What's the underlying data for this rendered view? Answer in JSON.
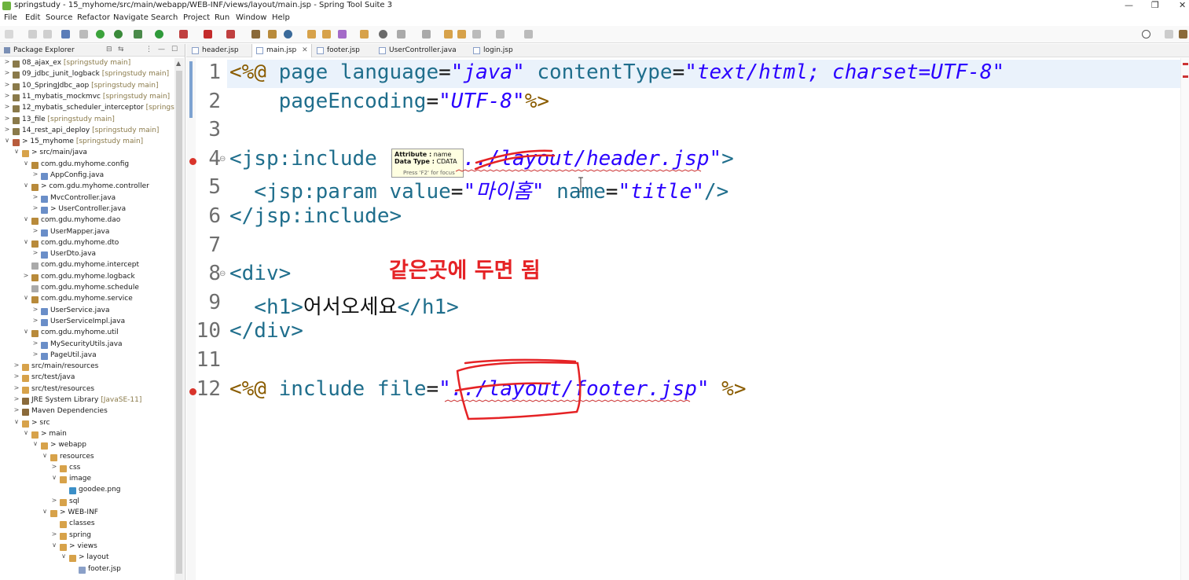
{
  "window": {
    "title": "springstudy - 15_myhome/src/main/webapp/WEB-INF/views/layout/main.jsp - Spring Tool Suite 3",
    "controls": {
      "minimize": "—",
      "restore": "❐",
      "close": "✕"
    }
  },
  "menu": [
    "File",
    "Edit",
    "Source",
    "Refactor",
    "Navigate",
    "Search",
    "Project",
    "Run",
    "Window",
    "Help"
  ],
  "package_explorer": {
    "title": "Package Explorer",
    "buttons": {
      "collapse": "⊟",
      "link": "⇆",
      "menu": "⋮",
      "minimize": "—",
      "maximize": "☐"
    },
    "scroll_up": "▲",
    "items": [
      {
        "twisty": ">",
        "label": "08_ajax_ex",
        "meta": " [springstudy main]",
        "icon_color": "#8a7a4a"
      },
      {
        "twisty": ">",
        "label": "09_jdbc_junit_logback",
        "meta": " [springstudy main]",
        "icon_color": "#8a7a4a"
      },
      {
        "twisty": ">",
        "label": "10_SpringJdbc_aop",
        "meta": " [springstudy main]",
        "icon_color": "#8a7a4a"
      },
      {
        "twisty": ">",
        "label": "11_mybatis_mockmvc",
        "meta": " [springstudy main]",
        "icon_color": "#8a7a4a"
      },
      {
        "twisty": ">",
        "label": "12_mybatis_scheduler_interceptor",
        "meta": " [springstu",
        "icon_color": "#8a7a4a"
      },
      {
        "twisty": ">",
        "label": "13_file",
        "meta": " [springstudy main]",
        "icon_color": "#8a7a4a"
      },
      {
        "twisty": ">",
        "label": "14_rest_api_deploy",
        "meta": " [springstudy main]",
        "icon_color": "#8a7a4a"
      },
      {
        "twisty": "∨",
        "label": "> 15_myhome",
        "meta": " [springstudy main]",
        "icon_color": "#b85c3c"
      },
      {
        "twisty": "∨",
        "label": "> src/main/java",
        "meta": "",
        "icon_color": "#d7a24a"
      },
      {
        "twisty": "∨",
        "label": "com.gdu.myhome.config",
        "meta": "",
        "icon_color": "#b88a3a"
      },
      {
        "twisty": ">",
        "label": "AppConfig.java",
        "meta": "",
        "icon_color": "#6a8ec8"
      },
      {
        "twisty": "∨",
        "label": "> com.gdu.myhome.controller",
        "meta": "",
        "icon_color": "#b88a3a"
      },
      {
        "twisty": ">",
        "label": "MvcController.java",
        "meta": "",
        "icon_color": "#6a8ec8"
      },
      {
        "twisty": ">",
        "label": "> UserController.java",
        "meta": "",
        "icon_color": "#6a8ec8"
      },
      {
        "twisty": "∨",
        "label": "com.gdu.myhome.dao",
        "meta": "",
        "icon_color": "#b88a3a"
      },
      {
        "twisty": ">",
        "label": "UserMapper.java",
        "meta": "",
        "icon_color": "#6a8ec8"
      },
      {
        "twisty": "∨",
        "label": "com.gdu.myhome.dto",
        "meta": "",
        "icon_color": "#b88a3a"
      },
      {
        "twisty": ">",
        "label": "UserDto.java",
        "meta": "",
        "icon_color": "#6a8ec8"
      },
      {
        "twisty": "",
        "label": "com.gdu.myhome.intercept",
        "meta": "",
        "icon_color": "#aaaaaa"
      },
      {
        "twisty": ">",
        "label": "com.gdu.myhome.logback",
        "meta": "",
        "icon_color": "#b88a3a"
      },
      {
        "twisty": "",
        "label": "com.gdu.myhome.schedule",
        "meta": "",
        "icon_color": "#aaaaaa"
      },
      {
        "twisty": "∨",
        "label": "com.gdu.myhome.service",
        "meta": "",
        "icon_color": "#b88a3a"
      },
      {
        "twisty": ">",
        "label": "UserService.java",
        "meta": "",
        "icon_color": "#6a8ec8"
      },
      {
        "twisty": ">",
        "label": "UserServiceImpl.java",
        "meta": "",
        "icon_color": "#6a8ec8"
      },
      {
        "twisty": "∨",
        "label": "com.gdu.myhome.util",
        "meta": "",
        "icon_color": "#b88a3a"
      },
      {
        "twisty": ">",
        "label": "MySecurityUtils.java",
        "meta": "",
        "icon_color": "#6a8ec8"
      },
      {
        "twisty": ">",
        "label": "PageUtil.java",
        "meta": "",
        "icon_color": "#6a8ec8"
      },
      {
        "twisty": ">",
        "label": "src/main/resources",
        "meta": "",
        "icon_color": "#d7a24a"
      },
      {
        "twisty": ">",
        "label": "src/test/java",
        "meta": "",
        "icon_color": "#d7a24a"
      },
      {
        "twisty": ">",
        "label": "src/test/resources",
        "meta": "",
        "icon_color": "#d7a24a"
      },
      {
        "twisty": ">",
        "label": "JRE System Library",
        "meta": " [JavaSE-11]",
        "icon_color": "#8a6a3a"
      },
      {
        "twisty": ">",
        "label": "Maven Dependencies",
        "meta": "",
        "icon_color": "#8a6a3a"
      },
      {
        "twisty": "∨",
        "label": "> src",
        "meta": "",
        "icon_color": "#d7a24a"
      },
      {
        "twisty": "∨",
        "label": "> main",
        "meta": "",
        "icon_color": "#d7a24a"
      },
      {
        "twisty": "∨",
        "label": "> webapp",
        "meta": "",
        "icon_color": "#d7a24a"
      },
      {
        "twisty": "∨",
        "label": "resources",
        "meta": "",
        "icon_color": "#d7a24a"
      },
      {
        "twisty": ">",
        "label": "css",
        "meta": "",
        "icon_color": "#d7a24a"
      },
      {
        "twisty": "∨",
        "label": "image",
        "meta": "",
        "icon_color": "#d7a24a"
      },
      {
        "twisty": "",
        "label": "goodee.png",
        "meta": "",
        "icon_color": "#3a8fc8"
      },
      {
        "twisty": ">",
        "label": "sql",
        "meta": "",
        "icon_color": "#d7a24a"
      },
      {
        "twisty": "∨",
        "label": "> WEB-INF",
        "meta": "",
        "icon_color": "#d7a24a"
      },
      {
        "twisty": "",
        "label": "classes",
        "meta": "",
        "icon_color": "#d7a24a"
      },
      {
        "twisty": ">",
        "label": "spring",
        "meta": "",
        "icon_color": "#d7a24a"
      },
      {
        "twisty": "∨",
        "label": "> views",
        "meta": "",
        "icon_color": "#d7a24a"
      },
      {
        "twisty": "∨",
        "label": "> layout",
        "meta": "",
        "icon_color": "#d7a24a"
      },
      {
        "twisty": "",
        "label": "footer.jsp",
        "meta": "",
        "icon_color": "#8aa0c8"
      }
    ]
  },
  "editor_tabs": [
    {
      "label": "header.jsp",
      "active": false
    },
    {
      "label": "main.jsp",
      "active": true
    },
    {
      "label": "footer.jsp",
      "active": false
    },
    {
      "label": "UserController.java",
      "active": false
    },
    {
      "label": "login.jsp",
      "active": false
    }
  ],
  "editor_tab_close": "✕",
  "code": {
    "line_numbers": [
      "1",
      "2",
      "3",
      "4",
      "5",
      "6",
      "7",
      "8",
      "9",
      "10",
      "11",
      "12"
    ],
    "lines": [
      [
        {
          "t": "<%@ ",
          "c": "k-dir"
        },
        {
          "t": "page ",
          "c": "k-tag"
        },
        {
          "t": "language",
          "c": "k-tag"
        },
        {
          "t": "=",
          "c": "k-plain"
        },
        {
          "t": "\"java\"",
          "c": "k-str"
        },
        {
          "t": " contentType",
          "c": "k-tag"
        },
        {
          "t": "=",
          "c": "k-plain"
        },
        {
          "t": "\"text/html; charset=UTF-8\"",
          "c": "k-str"
        }
      ],
      [
        {
          "t": "    pageEncoding",
          "c": "k-tag"
        },
        {
          "t": "=",
          "c": "k-plain"
        },
        {
          "t": "\"UTF-8\"",
          "c": "k-str"
        },
        {
          "t": "%>",
          "c": "k-dir"
        }
      ],
      [],
      [
        {
          "t": "<jsp:include ",
          "c": "k-tag"
        },
        {
          "t": "page",
          "c": "k-tag"
        },
        {
          "t": "=",
          "c": "k-plain"
        },
        {
          "t": "\"../layout/header.jsp\"",
          "c": "k-str"
        },
        {
          "t": ">",
          "c": "k-tag"
        }
      ],
      [
        {
          "t": "  <jsp:param ",
          "c": "k-tag"
        },
        {
          "t": "value",
          "c": "k-tag"
        },
        {
          "t": "=",
          "c": "k-plain"
        },
        {
          "t": "\"마이홈\"",
          "c": "k-str"
        },
        {
          "t": " name",
          "c": "k-tag"
        },
        {
          "t": "=",
          "c": "k-plain"
        },
        {
          "t": "\"title\"",
          "c": "k-str"
        },
        {
          "t": "/>",
          "c": "k-tag"
        }
      ],
      [
        {
          "t": "</jsp:include>",
          "c": "k-tag"
        }
      ],
      [],
      [
        {
          "t": "<div>",
          "c": "k-tag"
        }
      ],
      [
        {
          "t": "  <h1>",
          "c": "k-tag"
        },
        {
          "t": "어서오세요",
          "c": "k-plain"
        },
        {
          "t": "</h1>",
          "c": "k-tag"
        }
      ],
      [
        {
          "t": "</div>",
          "c": "k-tag"
        }
      ],
      [],
      [
        {
          "t": "<%@ ",
          "c": "k-dir"
        },
        {
          "t": "include ",
          "c": "k-tag"
        },
        {
          "t": "file",
          "c": "k-tag"
        },
        {
          "t": "=",
          "c": "k-plain"
        },
        {
          "t": "\"../layout/footer.jsp\"",
          "c": "k-str"
        },
        {
          "t": " %>",
          "c": "k-dir"
        }
      ]
    ],
    "error_lines": [
      4,
      12
    ],
    "fold_lines": [
      4,
      8
    ]
  },
  "tooltip": {
    "attr_label": "Attribute :",
    "attr_value": " name",
    "type_label": "Data Type :",
    "type_value": " CDATA",
    "hint": "Press 'F2' for focus"
  },
  "annotation": "같은곳에 두면 됨",
  "colors": {
    "ink_red": "#e52225"
  }
}
